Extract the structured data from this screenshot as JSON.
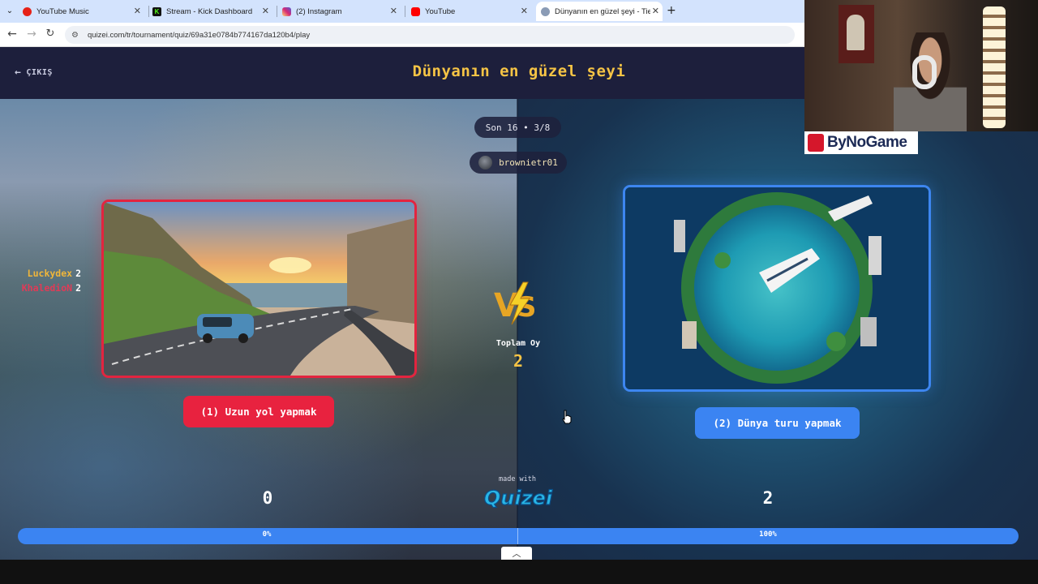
{
  "browser": {
    "tabs": [
      {
        "title": "YouTube Music",
        "color": "#e62117"
      },
      {
        "title": "Stream - Kick Dashboard",
        "color": "#111111"
      },
      {
        "title": "(2) Instagram",
        "color": "#d62976"
      },
      {
        "title": "YouTube",
        "color": "#ff0000"
      },
      {
        "title": "Dünyanın en güzel şeyi - Tier L...",
        "color": "#8a9bb5",
        "active": true
      }
    ],
    "url": "quizei.com/tr/tournament/quiz/69a31e0784b774167da120b4/play"
  },
  "header": {
    "exit_label": "ÇIKIŞ",
    "title": "Dünyanın en güzel şeyi"
  },
  "round": {
    "label": "Son 16 • 3/8",
    "player": "brownietr01"
  },
  "voters": [
    {
      "name": "Luckydex",
      "score": "2",
      "color": "#f0b63a"
    },
    {
      "name": "KhaledioN",
      "score": "2",
      "color": "#e23a56"
    }
  ],
  "choices": {
    "left": {
      "label": "(1) Uzun yol yapmak",
      "votes": "0",
      "percent": "0%",
      "color": "#e8223f"
    },
    "right": {
      "label": "(2) Dünya turu yapmak",
      "votes": "2",
      "percent": "100%",
      "color": "#3b84f2"
    }
  },
  "total": {
    "label": "Toplam Oy",
    "value": "2"
  },
  "branding": {
    "made_with": "made with",
    "logo": "Quizei"
  },
  "overlay": {
    "sponsor": "ByNoGame"
  }
}
